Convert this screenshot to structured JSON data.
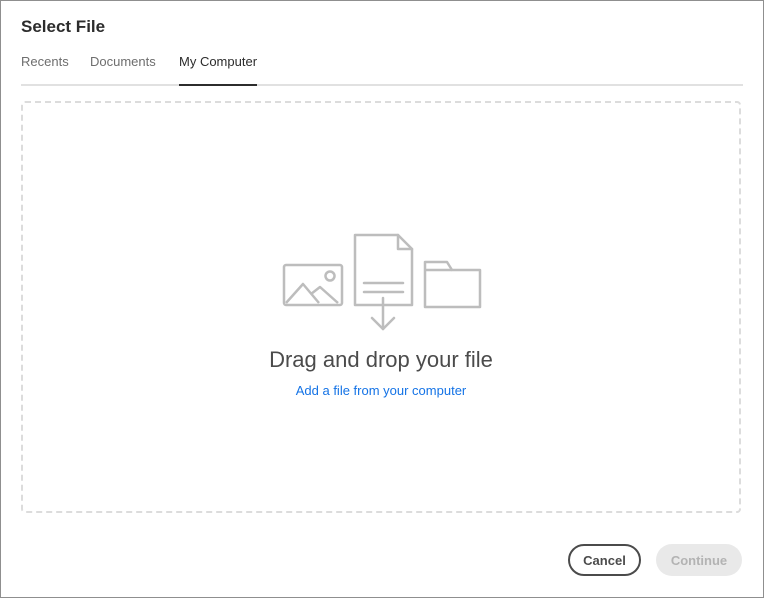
{
  "dialog": {
    "title": "Select File"
  },
  "tabs": [
    {
      "label": "Recents",
      "active": false
    },
    {
      "label": "Documents",
      "active": false
    },
    {
      "label": "My Computer",
      "active": true
    }
  ],
  "dropzone": {
    "icons": [
      "image-icon",
      "document-download-icon",
      "folder-icon"
    ],
    "title": "Drag and drop your file",
    "link_label": "Add a file from your computer"
  },
  "footer": {
    "cancel_label": "Cancel",
    "continue_label": "Continue",
    "continue_enabled": false
  },
  "colors": {
    "accent": "#1473e6",
    "text": "#2c2c2c",
    "disabled_bg": "#e9e9e9",
    "icon_gray": "#bdbdbd"
  }
}
